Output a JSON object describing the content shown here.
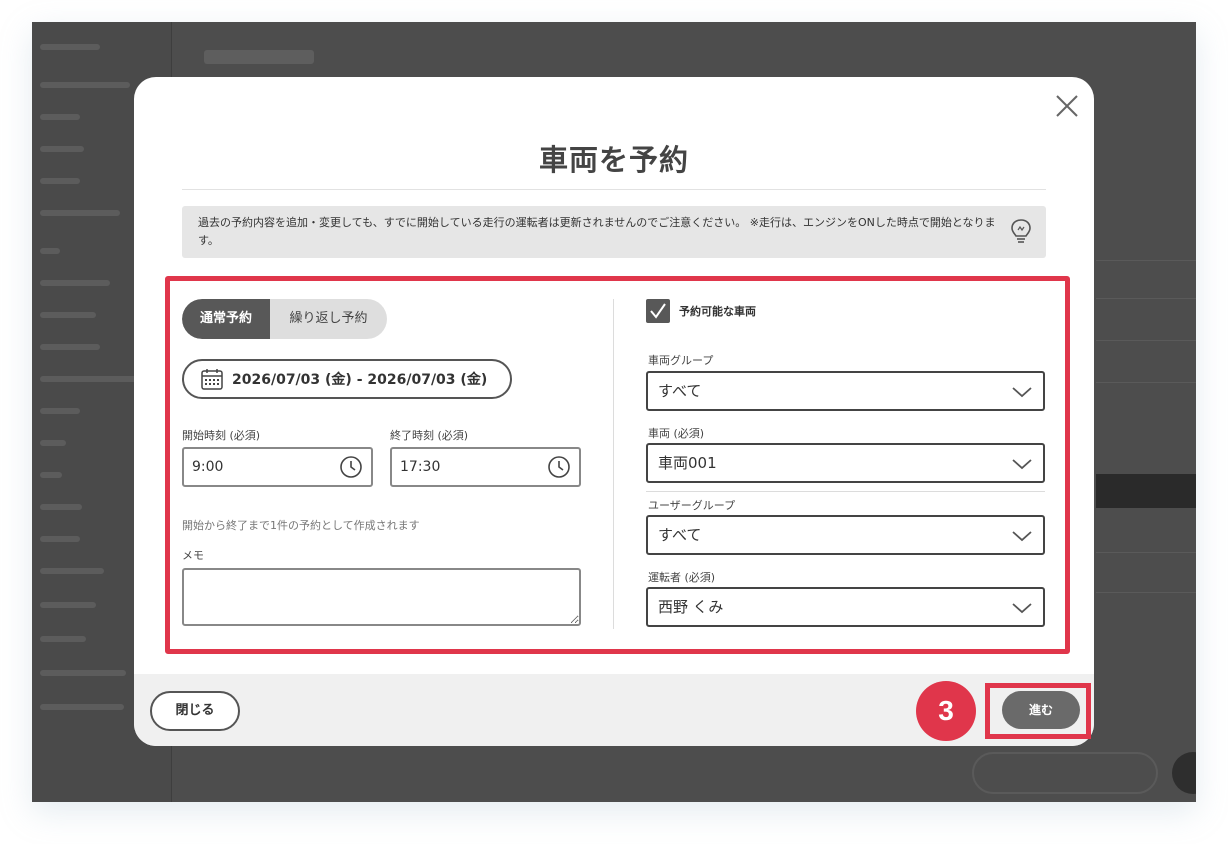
{
  "dialog": {
    "title": "車両を予約",
    "notice": "過去の予約内容を追加・変更しても、すでに開始している走行の運転者は更新されませんのでご注意ください。 ※走行は、エンジンをONした時点で開始となります。"
  },
  "tabs": [
    {
      "label": "通常予約",
      "active": true
    },
    {
      "label": "繰り返し予約",
      "active": false
    }
  ],
  "date_range": "2026/07/03 (金) - 2026/07/03 (金)",
  "start_time": {
    "label": "開始時刻 (必須)",
    "value": "9:00"
  },
  "end_time": {
    "label": "終了時刻 (必須)",
    "value": "17:30"
  },
  "hint": "開始から終了まで1件の予約として作成されます",
  "memo": {
    "label": "メモ",
    "value": ""
  },
  "available_vehicles": {
    "label": "予約可能な車両",
    "checked": true
  },
  "vehicle_group": {
    "label": "車両グループ",
    "value": "すべて"
  },
  "vehicle": {
    "label": "車両 (必須)",
    "value": "車両001"
  },
  "user_group": {
    "label": "ユーザーグループ",
    "value": "すべて"
  },
  "driver": {
    "label": "運転者 (必須)",
    "value": "西野 くみ"
  },
  "footer": {
    "close_label": "閉じる",
    "next_label": "進む"
  },
  "annotation": {
    "step_number": "3",
    "color": "#e0364b"
  },
  "colors": {
    "accent_dark": "#585858",
    "overlay": "#4d4d4d"
  },
  "icons": [
    "close-icon",
    "lightbulb-icon",
    "calendar-icon",
    "clock-icon",
    "checkmark-icon",
    "chevron-down-icon"
  ]
}
